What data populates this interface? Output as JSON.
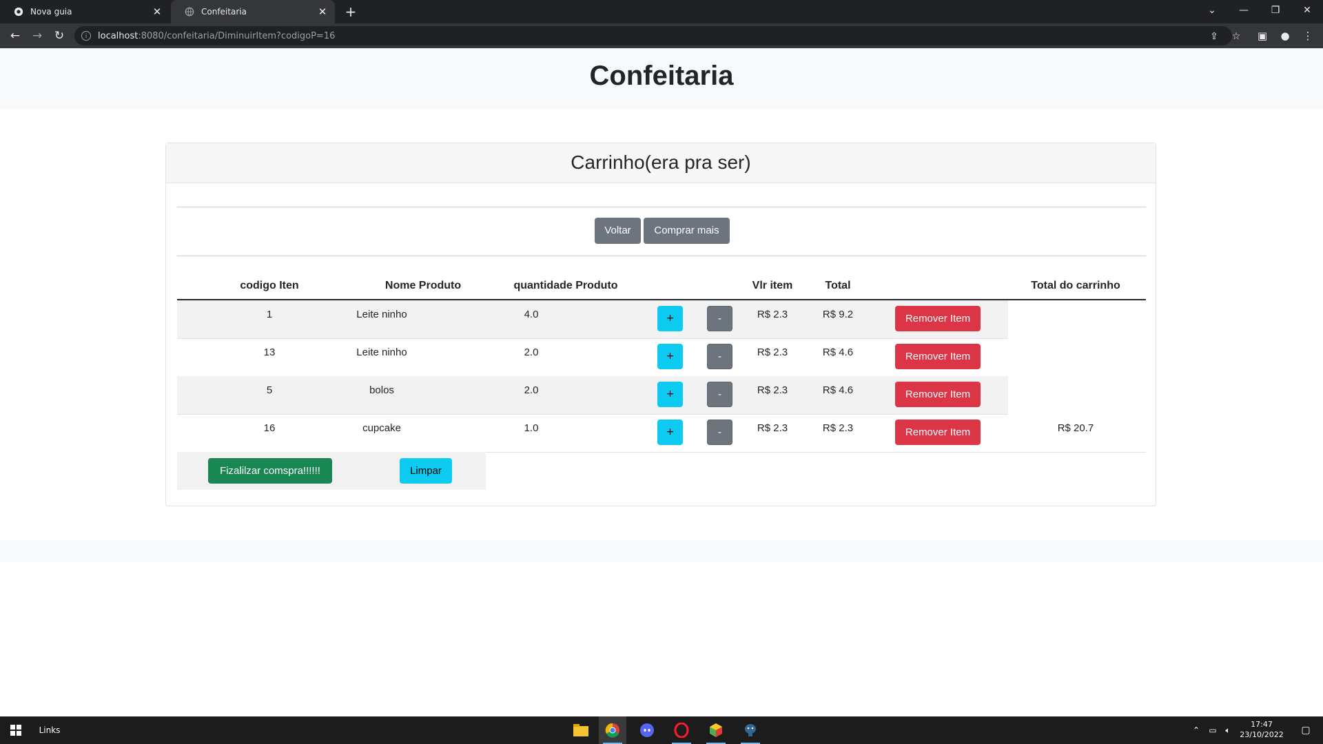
{
  "browser": {
    "tabs": [
      {
        "title": "Nova guia",
        "active": false
      },
      {
        "title": "Confeitaria",
        "active": true
      }
    ],
    "new_tab_symbol": "+",
    "url_host": "localhost",
    "url_rest": ":8080/confeitaria/DiminuirItem?codigoP=16",
    "window_controls": {
      "dropdown": "⌄",
      "minimize": "—",
      "restore": "❐",
      "close": "✕"
    }
  },
  "page": {
    "title": "Confeitaria",
    "card_title": "Carrinho(era pra ser)",
    "buttons": {
      "voltar": "Voltar",
      "comprar_mais": "Comprar mais",
      "finalizar": "Fizalilzar comspra!!!!!!",
      "limpar": "Limpar"
    },
    "table": {
      "headers": [
        "codigo Iten",
        "Nome Produto",
        "quantidade Produto",
        "Vlr item",
        "Total",
        "Total do carrinho"
      ],
      "plus_label": "+",
      "minus_label": "-",
      "remove_label": "Remover Item",
      "rows": [
        {
          "codigo": "1",
          "nome": "Leite ninho",
          "quantidade": "4.0",
          "vlr_item": "R$ 2.3",
          "total": "R$ 9.2"
        },
        {
          "codigo": "13",
          "nome": "Leite ninho",
          "quantidade": "2.0",
          "vlr_item": "R$ 2.3",
          "total": "R$ 4.6"
        },
        {
          "codigo": "5",
          "nome": "bolos",
          "quantidade": "2.0",
          "vlr_item": "R$ 2.3",
          "total": "R$ 4.6"
        },
        {
          "codigo": "16",
          "nome": "cupcake",
          "quantidade": "1.0",
          "vlr_item": "R$ 2.3",
          "total": "R$ 2.3"
        }
      ],
      "total_carrinho": "R$ 20.7"
    }
  },
  "taskbar": {
    "links_label": "Links",
    "apps": [
      "file-explorer-icon",
      "chrome-icon",
      "discord-icon",
      "opera-icon",
      "app-icon",
      "postgresql-icon"
    ],
    "time": "17:47",
    "date": "23/10/2022"
  },
  "colors": {
    "primary_info": "#0dcaf0",
    "secondary": "#6c757d",
    "danger": "#dc3545",
    "success": "#198754"
  }
}
